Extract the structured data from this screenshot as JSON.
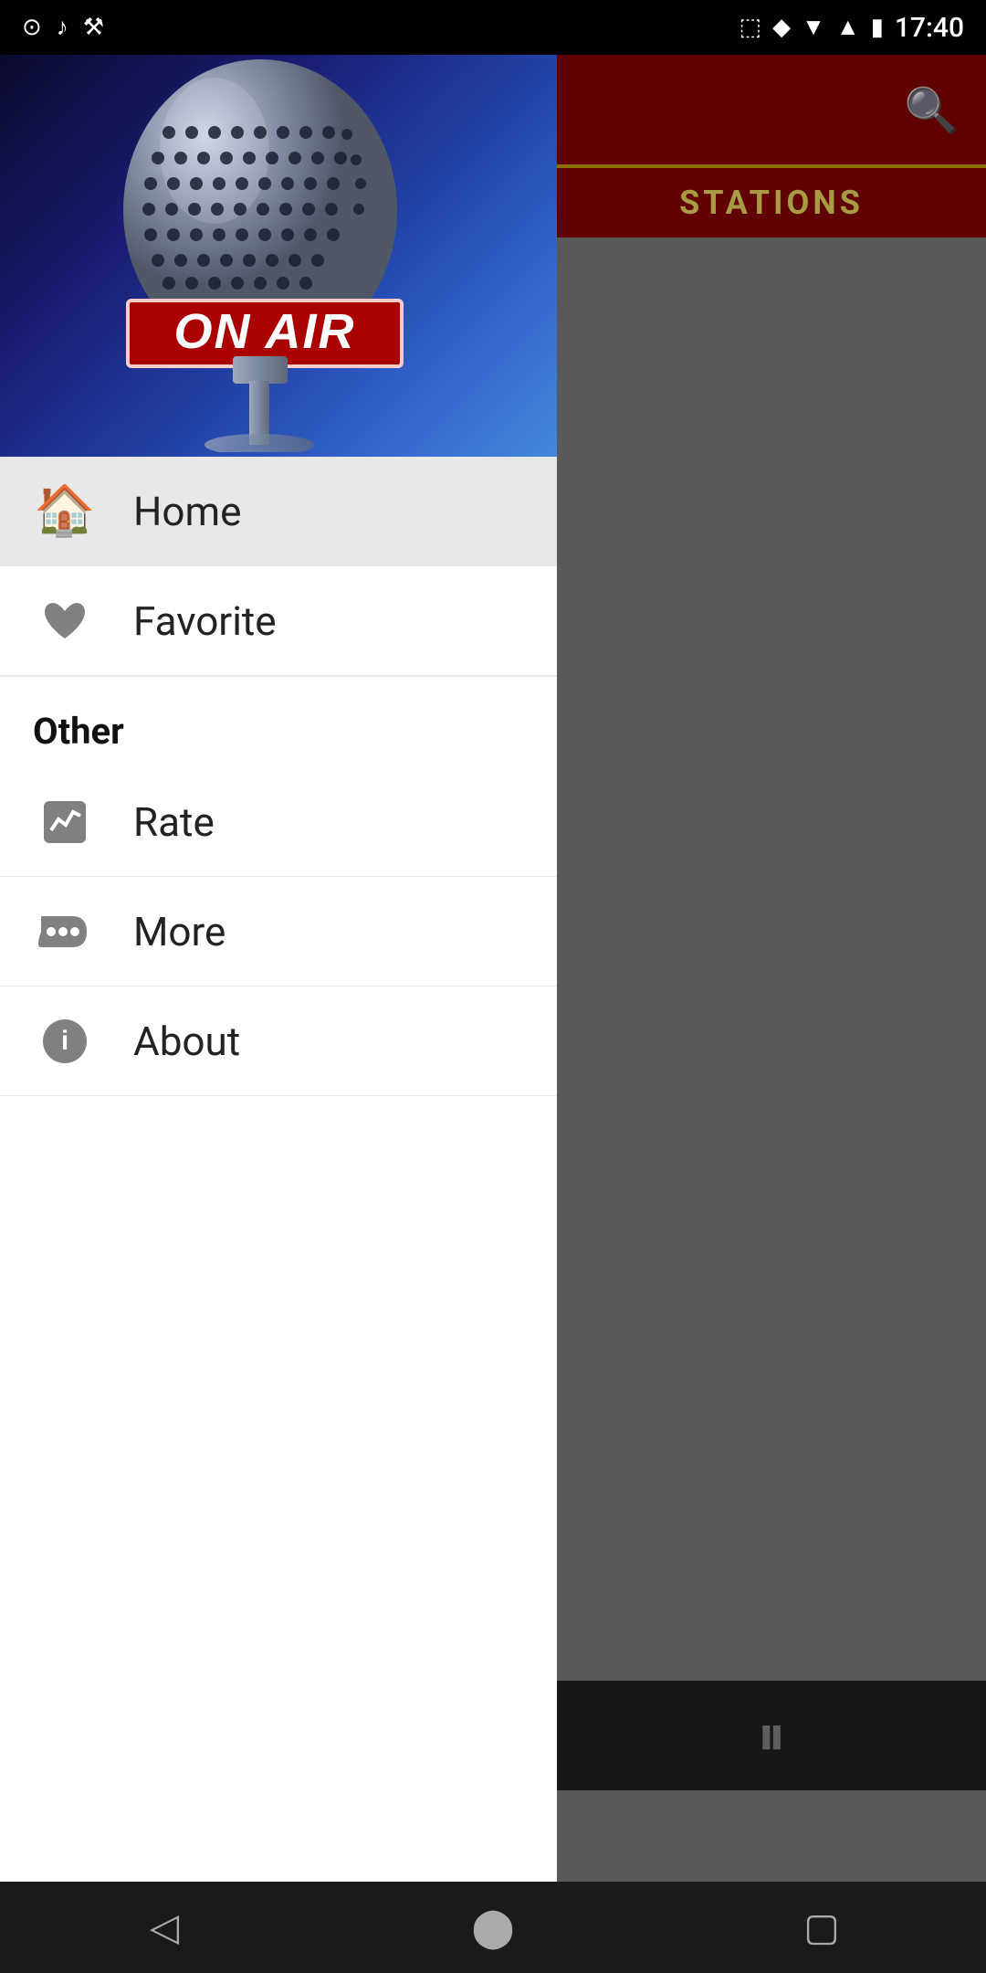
{
  "statusBar": {
    "time": "17:40",
    "icons": {
      "camera": "📷",
      "music": "♪",
      "tool": "🔧"
    }
  },
  "hero": {
    "onAirText": "ON AIR"
  },
  "menu": {
    "homeLabel": "Home",
    "favoriteLabel": "Favorite",
    "sectionOtherLabel": "Other",
    "rateLabel": "Rate",
    "moreLabel": "More",
    "aboutLabel": "About"
  },
  "rightPanel": {
    "stationsLabel": "STATIONS"
  },
  "player": {
    "pauseSymbol": "⏸"
  },
  "bottomNav": {
    "backLabel": "◁",
    "homeLabel": "⬤",
    "recentLabel": "▢"
  }
}
